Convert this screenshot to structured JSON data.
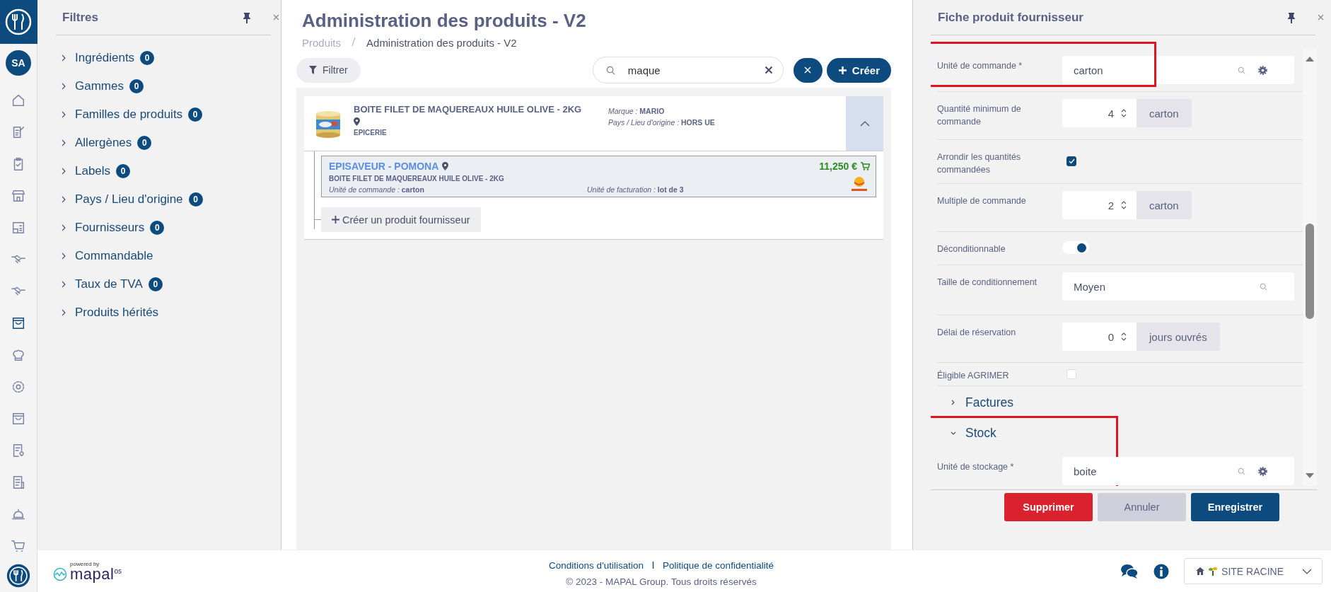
{
  "nav_rail": {
    "avatar": "SA",
    "items": [
      {
        "selected": false
      },
      {
        "selected": false
      },
      {
        "selected": false
      },
      {
        "selected": false
      },
      {
        "selected": false
      },
      {
        "selected": false
      },
      {
        "selected": false
      },
      {
        "selected": true
      },
      {
        "selected": false
      },
      {
        "selected": false
      },
      {
        "selected": false
      },
      {
        "selected": false
      },
      {
        "selected": false
      },
      {
        "selected": false
      },
      {
        "selected": false
      }
    ]
  },
  "filters": {
    "title": "Filtres",
    "items": [
      {
        "label": "Ingrédients",
        "count": "0",
        "expanded": false
      },
      {
        "label": "Gammes",
        "count": "0",
        "expanded": false
      },
      {
        "label": "Familles de produits",
        "count": "0",
        "expanded": false
      },
      {
        "label": "Allergènes",
        "count": "0",
        "expanded": false
      },
      {
        "label": "Labels",
        "count": "0",
        "expanded": false
      },
      {
        "label": "Pays / Lieu d'origine",
        "count": "0",
        "expanded": false
      },
      {
        "label": "Fournisseurs",
        "count": "0",
        "expanded": false
      },
      {
        "label": "Commandable",
        "expanded": false
      },
      {
        "label": "Taux de TVA",
        "count": "0",
        "expanded": false
      },
      {
        "label": "Produits hérités",
        "expanded": false
      }
    ]
  },
  "main": {
    "title": "Administration des produits - V2",
    "breadcrumb": [
      "Produits",
      "Administration des produits - V2"
    ],
    "filter_button": "Filtrer",
    "search": {
      "value": "maque"
    },
    "create_button": "Créer",
    "product": {
      "name": "BOITE FILET DE MAQUEREAUX HUILE OLIVE - 2KG",
      "category": "EPICERIE",
      "expanded": true,
      "brand_label": "Marque :",
      "brand": "MARIO",
      "origin_label": "Pays / Lieu d'origine :",
      "origin": "HORS UE",
      "supplier": {
        "name": "EPISAVEUR - POMONA",
        "product": "BOITE FILET DE MAQUEREAUX HUILE OLIVE - 2KG",
        "price": "11,250 €",
        "order_unit_label": "Unité de commande :",
        "order_unit": "carton",
        "billing_unit_label": "Unité de facturation :",
        "billing_unit": "lot de 3"
      },
      "create_supplier_product": "Créer un produit fournisseur"
    }
  },
  "panel": {
    "title": "Fiche produit fournisseur",
    "fields": [
      {
        "kind": "lookup",
        "label": "Unité de commande *",
        "value": "carton",
        "highlighted": true
      },
      {
        "kind": "number",
        "label": "Quantité minimum de commande",
        "value": "4",
        "unit": "carton"
      },
      {
        "kind": "checkbox",
        "label": "Arrondir les quantités commandées",
        "checked": true
      },
      {
        "kind": "number",
        "label": "Multiple de commande",
        "value": "2",
        "unit": "carton"
      },
      {
        "kind": "toggle",
        "label": "Déconditionnable",
        "on": true
      },
      {
        "kind": "select",
        "label": "Taille de conditionnement",
        "value": "Moyen"
      },
      {
        "kind": "number",
        "label": "Délai de réservation",
        "value": "0",
        "unit": "jours ouvrés"
      },
      {
        "kind": "checkbox",
        "label": "Éligible AGRIMER",
        "checked": false
      }
    ],
    "sections": [
      {
        "label": "Factures",
        "expanded": false,
        "highlighted": false
      },
      {
        "label": "Stock",
        "expanded": true,
        "highlighted": true,
        "fields": [
          {
            "kind": "lookup",
            "label": "Unité de stockage *",
            "value": "boite"
          }
        ]
      }
    ],
    "buttons": [
      {
        "label": "Supprimer",
        "kind": "danger"
      },
      {
        "label": "Annuler",
        "kind": "secondary"
      },
      {
        "label": "Enregistrer",
        "kind": "primary"
      }
    ]
  },
  "footer": {
    "powered_by": "powered by",
    "logo": "mapal",
    "logo_suffix": "os",
    "links": [
      "Conditions d'utilisation",
      "Politique de confidentialité"
    ],
    "separator": "|",
    "copyright": "© 2023 - MAPAL Group. Tous droits réservés",
    "site": "SITE RACINE"
  }
}
